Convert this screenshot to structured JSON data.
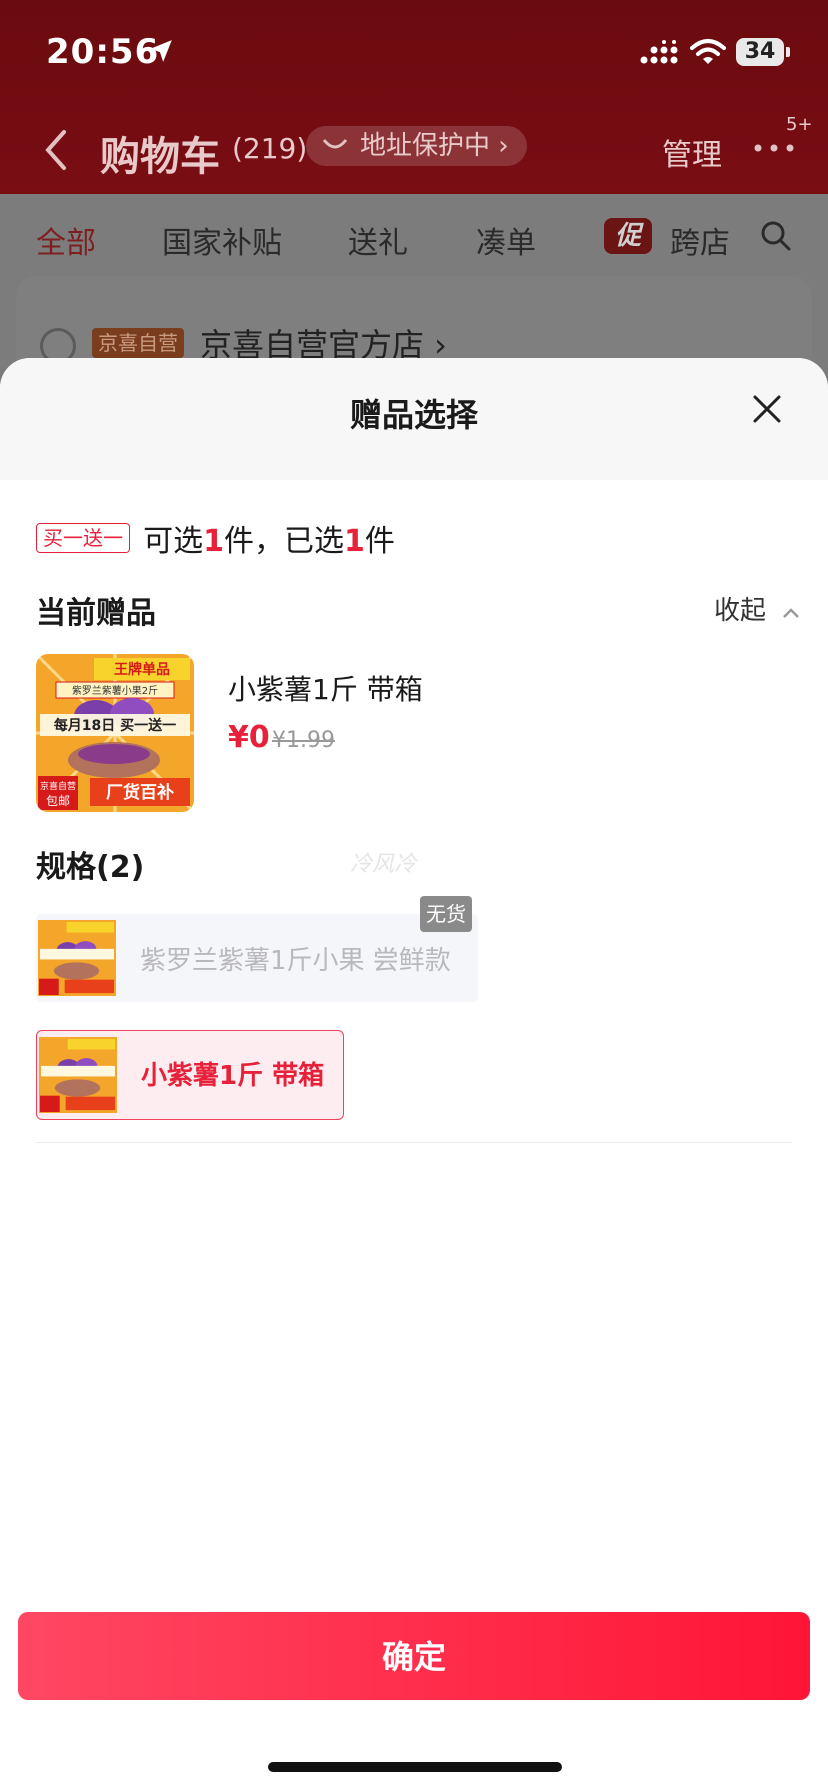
{
  "status": {
    "time": "20:56",
    "battery": "34"
  },
  "nav": {
    "title": "购物车",
    "count": "(219)",
    "address": "地址保护中 ›",
    "manage": "管理",
    "badge": "5+"
  },
  "tabs": [
    {
      "label": "全部"
    },
    {
      "label": "国家补贴"
    },
    {
      "label": "送礼"
    },
    {
      "label": "凑单"
    },
    {
      "label": "跨店"
    }
  ],
  "promo_badge": "促",
  "store": {
    "tag": "京喜自营",
    "name": "京喜自营官方店 ›"
  },
  "sheet": {
    "title": "赠品选择",
    "rule": {
      "tag": "买一送一",
      "text_a": "可选",
      "num_a": "1",
      "text_b": "件，已选",
      "num_b": "1",
      "text_c": "件"
    },
    "current_title": "当前赠品",
    "collapse": "收起",
    "gift": {
      "name": "小紫薯1斤 带箱",
      "price": "¥0",
      "original_price": "¥1.99"
    },
    "spec_title": "规格(2)",
    "watermark": "冷风冷",
    "specs": [
      {
        "label": "紫罗兰紫薯1斤小果 尝鲜款",
        "badge": "无货"
      },
      {
        "label": "小紫薯1斤 带箱"
      }
    ],
    "product_image": {
      "banner": "王牌单品",
      "sub": "紫罗兰紫薯小果2斤",
      "promo": "每月18日 买一送一",
      "tag1": "京喜自营",
      "tag2": "包邮",
      "tag3": "厂货百补"
    },
    "confirm": "确定"
  }
}
